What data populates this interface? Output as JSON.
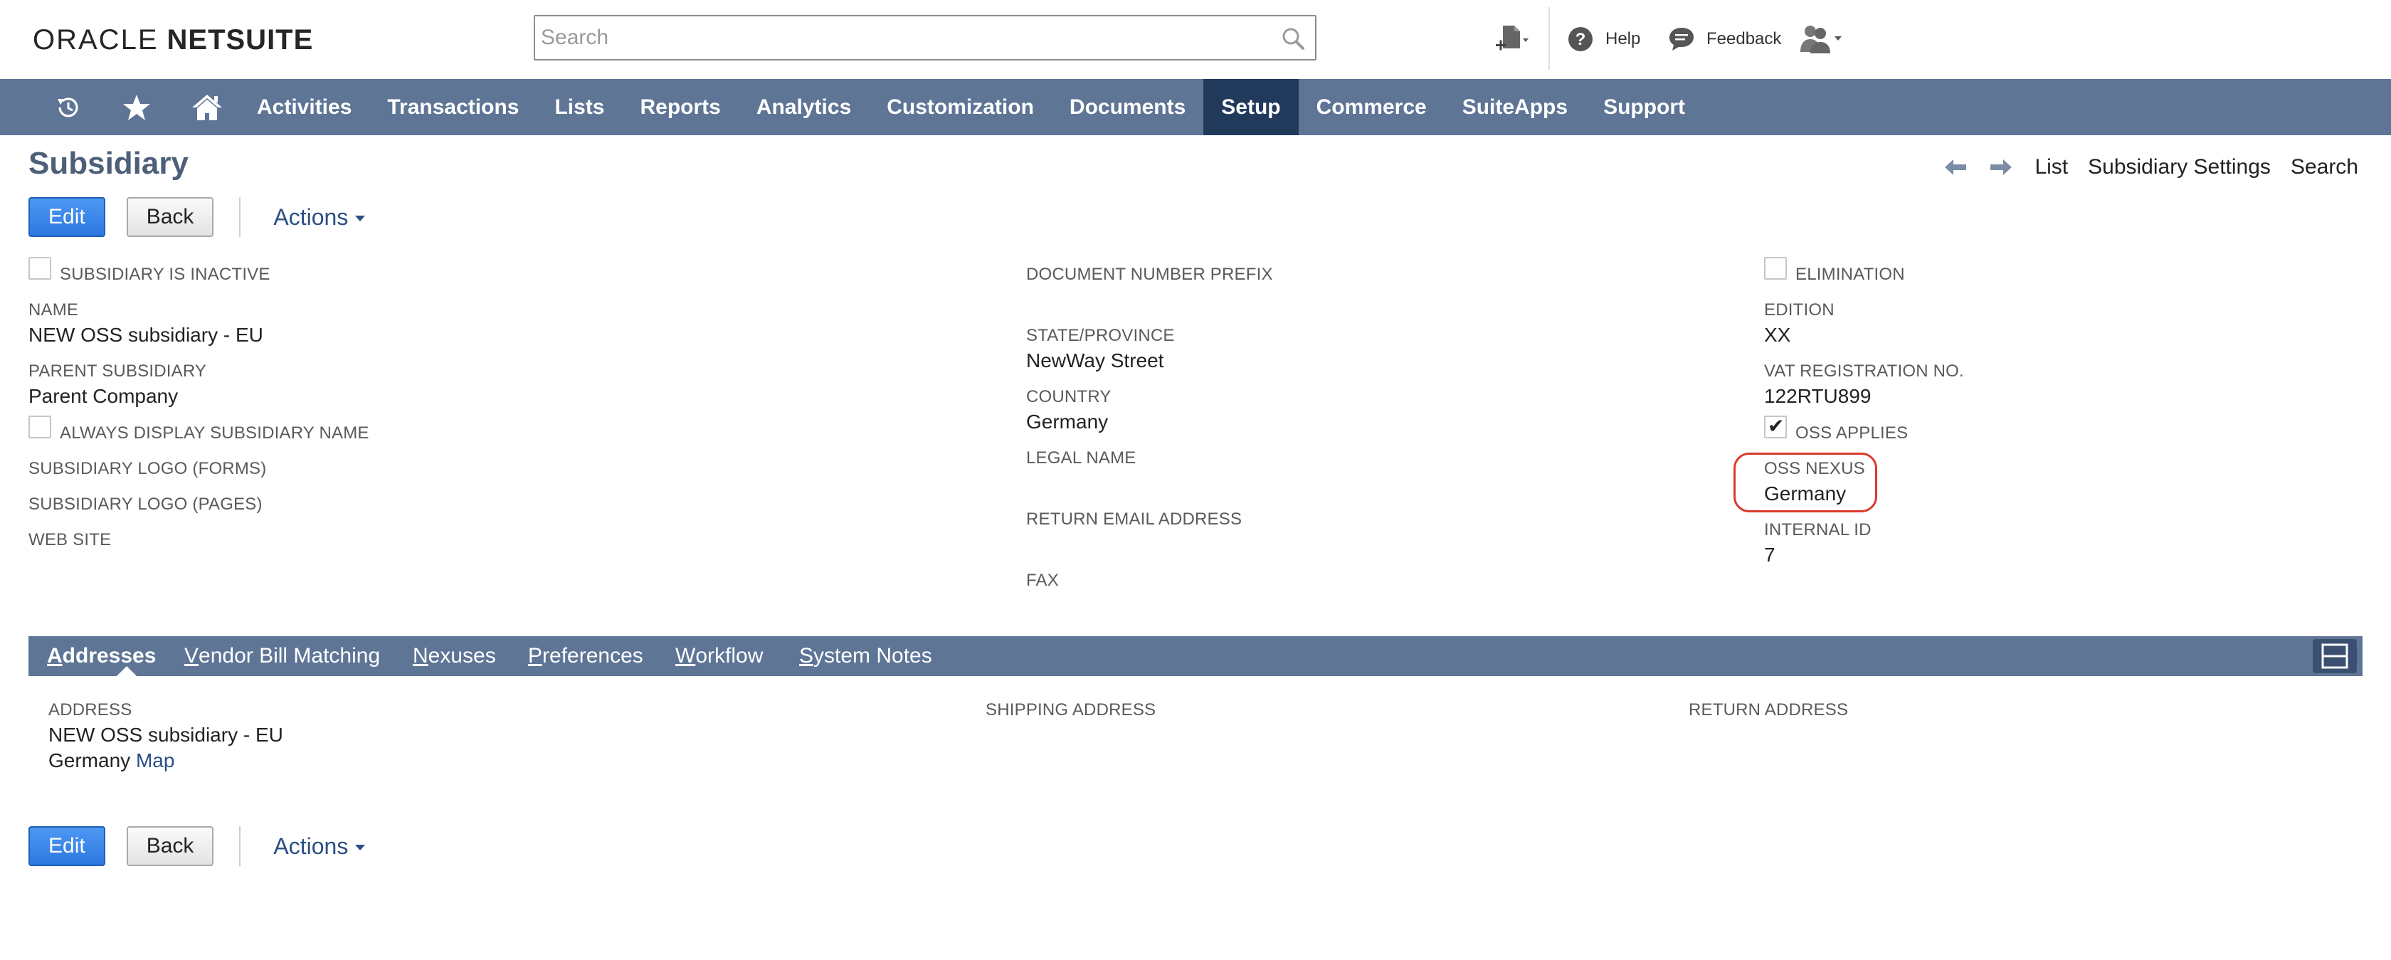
{
  "header": {
    "logo_part1": "ORACLE",
    "logo_part2": "NETSUITE",
    "search_placeholder": "Search",
    "help_label": "Help",
    "feedback_label": "Feedback"
  },
  "nav": {
    "items": [
      {
        "label": "Activities"
      },
      {
        "label": "Transactions"
      },
      {
        "label": "Lists"
      },
      {
        "label": "Reports"
      },
      {
        "label": "Analytics"
      },
      {
        "label": "Customization"
      },
      {
        "label": "Documents"
      },
      {
        "label": "Setup",
        "active": true
      },
      {
        "label": "Commerce"
      },
      {
        "label": "SuiteApps"
      },
      {
        "label": "Support"
      }
    ]
  },
  "page": {
    "title": "Subsidiary",
    "links": {
      "list": "List",
      "settings": "Subsidiary Settings",
      "search": "Search"
    }
  },
  "buttons": {
    "edit": "Edit",
    "back": "Back",
    "actions": "Actions"
  },
  "fields": {
    "inactive_label": "Subsidiary is Inactive",
    "name_label": "Name",
    "name_value": "NEW OSS subsidiary - EU",
    "parent_label": "Parent Subsidiary",
    "parent_value": "Parent Company",
    "always_display_label": "Always Display Subsidiary Name",
    "logo_forms_label": "Subsidiary Logo (Forms)",
    "logo_pages_label": "Subsidiary Logo (Pages)",
    "website_label": "Web Site",
    "doc_prefix_label": "Document Number Prefix",
    "state_label": "State/Province",
    "state_value": "NewWay Street",
    "country_label": "Country",
    "country_value": "Germany",
    "legal_name_label": "Legal Name",
    "return_email_label": "Return Email Address",
    "fax_label": "Fax",
    "elimination_label": "Elimination",
    "edition_label": "Edition",
    "edition_value": "XX",
    "vat_label": "VAT Registration No.",
    "vat_value": "122RTU899",
    "oss_applies_label": "OSS Applies",
    "oss_applies_checked": true,
    "oss_nexus_label": "OSS Nexus",
    "oss_nexus_value": "Germany",
    "internal_id_label": "Internal ID",
    "internal_id_value": "7"
  },
  "subtabs": {
    "items": [
      {
        "first": "A",
        "rest": "ddresses",
        "active": true
      },
      {
        "first": "V",
        "rest": "endor Bill Matching"
      },
      {
        "first": "N",
        "rest": "exuses"
      },
      {
        "first": "P",
        "rest": "references"
      },
      {
        "first": "W",
        "rest": "orkflow"
      },
      {
        "first": "S",
        "rest": "ystem Notes"
      }
    ]
  },
  "addresses": {
    "address_label": "Address",
    "address_line1": "NEW OSS subsidiary - EU",
    "address_line2": "Germany",
    "map_link": "Map",
    "shipping_label": "Shipping Address",
    "return_label": "Return Address"
  },
  "colors": {
    "nav_bg": "#5e7596",
    "nav_active": "#213a5c",
    "primary_button": "#3f8fef",
    "highlight": "#d93a2b",
    "link": "#2b4f83"
  }
}
